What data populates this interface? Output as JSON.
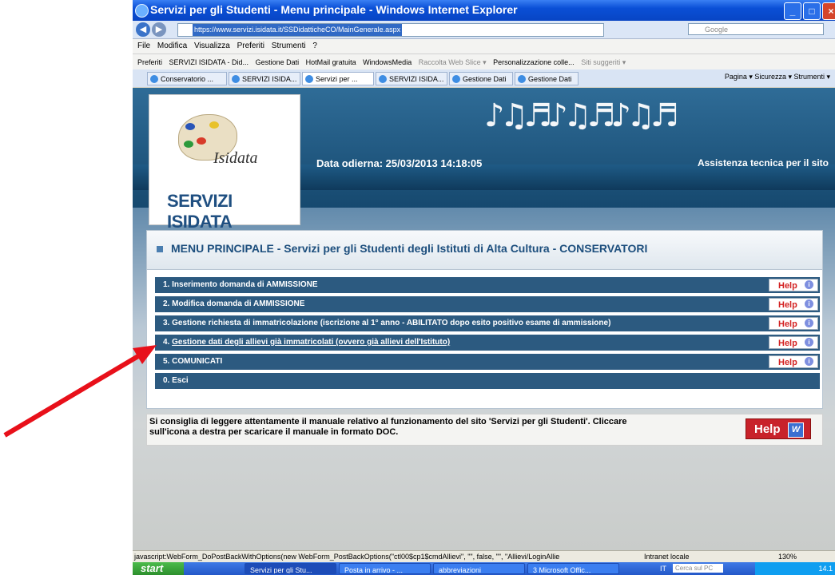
{
  "window": {
    "title": "Servizi per gli Studenti - Menu principale - Windows Internet Explorer",
    "url": "https://www.servizi.isidata.it/SSDidatticheCO/MainGenerale.aspx",
    "search_placeholder": "Google"
  },
  "menubar": [
    "File",
    "Modifica",
    "Visualizza",
    "Preferiti",
    "Strumenti",
    "?"
  ],
  "favorites": [
    "Preferiti",
    "SERVIZI ISIDATA - Did...",
    "Gestione Dati",
    "HotMail gratuita",
    "WindowsMedia",
    "Raccolta Web Slice ▾",
    "Personalizzazione colle...",
    "Siti suggeriti ▾"
  ],
  "tabs": [
    "Conservatorio ...",
    "SERVIZI ISIDA...",
    "Servizi per ...",
    "SERVIZI ISIDA...",
    "Gestione Dati",
    "Gestione Dati"
  ],
  "tab_tools": "Pagina ▾  Sicurezza ▾  Strumenti ▾",
  "banner": {
    "logo_brand": "Isidata",
    "logo_text": "SERVIZI ISIDATA",
    "date": "Data odierna: 25/03/2013 14:18:05",
    "assist": "Assistenza tecnica per il sito"
  },
  "menu": {
    "heading": "MENU PRINCIPALE - Servizi per gli Studenti degli Istituti di Alta Cultura - CONSERVATORI",
    "help_label": "Help",
    "items": [
      {
        "label": "1. Inserimento domanda di AMMISSIONE"
      },
      {
        "label": "2. Modifica domanda di AMMISSIONE"
      },
      {
        "label": "3. Gestione richiesta di immatricolazione (iscrizione al 1° anno - ABILITATO dopo esito positivo esame di ammissione)"
      },
      {
        "prefix": "4. ",
        "label": "Gestione dati degli allievi già immatricolati (ovvero già allievi dell'Istituto)"
      },
      {
        "label": "5. COMUNICATI"
      },
      {
        "label": "0. Esci"
      }
    ]
  },
  "manual": {
    "text": "Si consiglia di leggere attentamente il manuale relativo al funzionamento del sito 'Servizi per gli Studenti'. Cliccare sull'icona a destra per scaricare il manuale in formato DOC.",
    "button": "Help"
  },
  "status": {
    "link": "javascript:WebForm_DoPostBackWithOptions(new WebForm_PostBackOptions(\"ctl00$cp1$cmdAllievi\", \"\", false, \"\", \"Allievi/LoginAllie",
    "zone": "Intranet locale",
    "zoom": "130%"
  },
  "taskbar": {
    "start": "start",
    "tasks": [
      "Servizi per gli Stu...",
      "Posta in arrivo - ...",
      "abbreviazioni",
      "3 Microsoft Offic..."
    ],
    "lang": "IT",
    "search": "Cerca sul PC",
    "clock": "14.1"
  },
  "colors": {
    "arrow": "#e8101a",
    "row": "#2c5a80",
    "help": "#d32222"
  }
}
